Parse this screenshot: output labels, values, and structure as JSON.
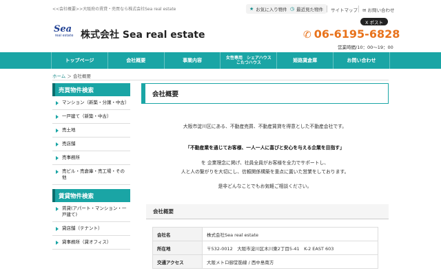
{
  "header": {
    "tagline": "<<会社概要>>大阪府の賃貸・売買なら株式会社Sea real estate",
    "favorites": "お気に入り物件",
    "recent": "最近見た物件",
    "sitemap": "サイトマップ",
    "contact": "お問い合わせ",
    "logo_word": "Sea",
    "logo_sub": "real estate",
    "company": "株式会社 Sea real estate",
    "x_post": "X ポスト",
    "phone": "06-6195-6828",
    "hours": "営業時間/10：00～19：00"
  },
  "nav": {
    "items": [
      {
        "label": "トップページ"
      },
      {
        "label": "会社概要"
      },
      {
        "label": "事業内容"
      },
      {
        "label": "女性専用　シェアハウス\nこたつハウス"
      },
      {
        "label": "姫路賃倉庫"
      },
      {
        "label": "お問い合わせ"
      }
    ]
  },
  "breadcrumb": {
    "home": "ホーム",
    "arrow": "＞",
    "current": "会社概要"
  },
  "sidebar": {
    "sale_title": "売買物件検索",
    "sale_items": [
      "マンション（新築・分譲・中古）",
      "一戸建て（新築・中古）",
      "売土地",
      "売店舗",
      "売事務所",
      "売ビル・売倉庫・売工場・その他"
    ],
    "rent_title": "賃貸物件検索",
    "rent_items": [
      "賃貸(アパート・マンション・一戸建て)",
      "貸店舗（テナント）",
      "貸事務所（貸オフィス）"
    ]
  },
  "main": {
    "title": "会社概要",
    "intro1": "大阪市淀川区にある、不動産売買、不動産賃貸を得意とした不動産会社です。",
    "motto": "「不動産業を通じてお客様、一人一人に喜びと安心を与える企業を目指す」",
    "intro2": "を 企業理念に掲げ、社員全員がお客様を全力でサポートし、",
    "intro3": "人と人の繋がりを大切にし、信頼関係構築を重点に置いた営業をしております。",
    "intro4": "是非どんなことでもお気軽ご相談ください。",
    "section_title": "会社概要",
    "table": [
      {
        "label": "会社名",
        "value": "株式会社Sea real estate"
      },
      {
        "label": "所在地",
        "value": "〒532-0012　大阪市淀川区木川東2丁目5-41　K-2 EAST 603"
      },
      {
        "label": "交通アクセス",
        "value": "大阪メトロ御堂筋線 / 西中島南方"
      }
    ]
  },
  "colors": {
    "accent": "#1aa5a5",
    "phone": "#e8731c",
    "logo": "#1f3f92"
  }
}
